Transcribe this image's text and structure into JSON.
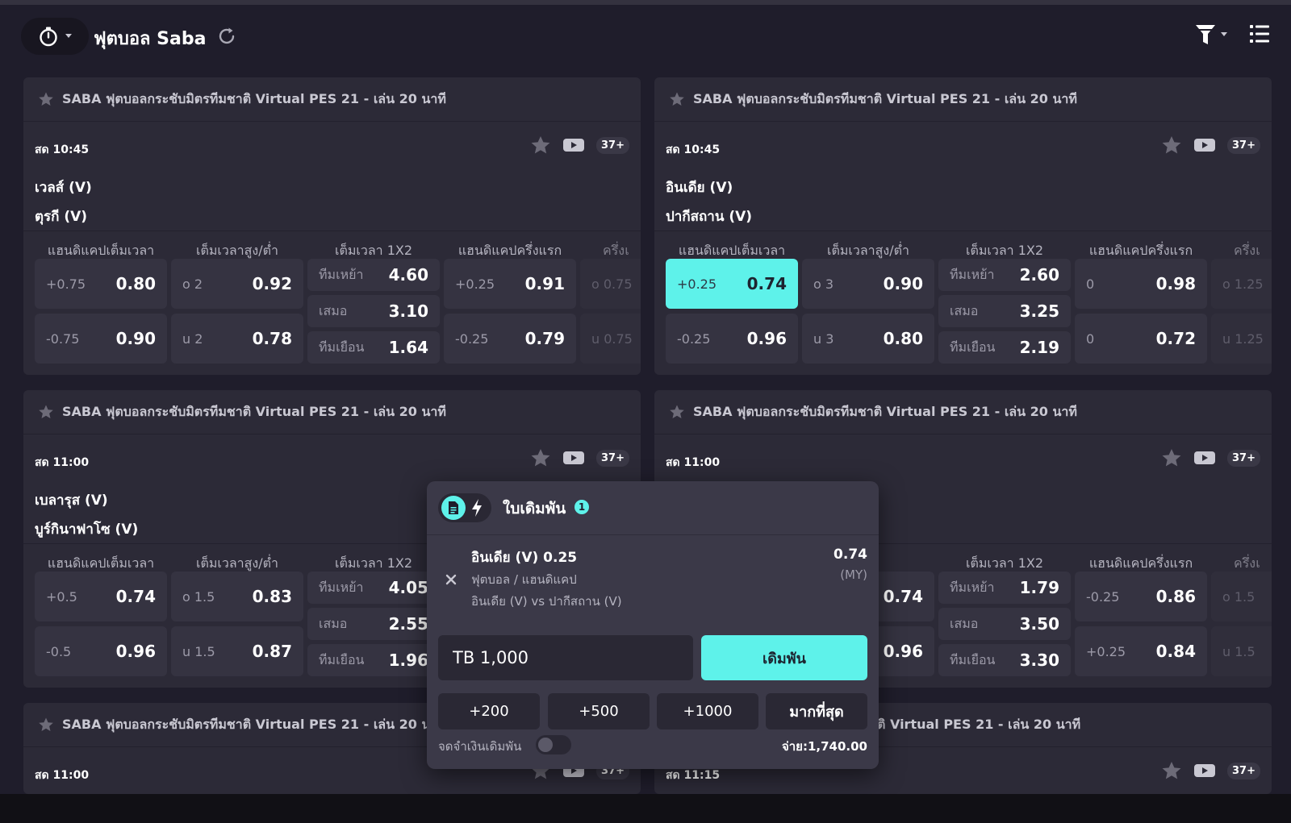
{
  "header": {
    "title": "ฟุตบอล Saba",
    "icons": {
      "timer": "stopwatch-icon",
      "refresh": "refresh-icon",
      "filter": "filter-icon",
      "list": "list-icon"
    }
  },
  "colors": {
    "background": "#1f1d2b",
    "card": "#2c2a37",
    "cell": "#353341",
    "accent": "#5ef2ea"
  },
  "market_headers": [
    "แฮนดิแคปเต็มเวลา",
    "เต็มเวลาสูง/ต่ำ",
    "เต็มเวลา 1X2",
    "แฮนดิแคปครึ่งแรก",
    "ครึ่งแ"
  ],
  "x12_labels": [
    "ทีมเหย้า",
    "เสมอ",
    "ทีมเยือน"
  ],
  "cards": [
    {
      "league": "SABA ฟุตบอลกระชับมิตรทีมชาติ Virtual PES 21 - เล่น 20 นาที",
      "time": "สด 10:45",
      "more": "37+",
      "home": "เวลส์ (V)",
      "away": "ตุรกี (V)",
      "hdp": [
        {
          "line": "+0.75",
          "odds": "0.80"
        },
        {
          "line": "-0.75",
          "odds": "0.90"
        }
      ],
      "ou": [
        {
          "line": "o 2",
          "odds": "0.92"
        },
        {
          "line": "u 2",
          "odds": "0.78"
        }
      ],
      "x12": [
        "4.60",
        "3.10",
        "1.64"
      ],
      "hdp1h": [
        {
          "line": "+0.25",
          "odds": "0.91"
        },
        {
          "line": "-0.25",
          "odds": "0.79"
        }
      ],
      "ou1h": [
        "o 0.75",
        "u 0.75"
      ]
    },
    {
      "league": "SABA ฟุตบอลกระชับมิตรทีมชาติ Virtual PES 21 - เล่น 20 นาที",
      "time": "สด 10:45",
      "more": "37+",
      "home": "อินเดีย (V)",
      "away": "ปากีสถาน (V)",
      "hdp": [
        {
          "line": "+0.25",
          "odds": "0.74",
          "selected": true
        },
        {
          "line": "-0.25",
          "odds": "0.96"
        }
      ],
      "ou": [
        {
          "line": "o 3",
          "odds": "0.90"
        },
        {
          "line": "u 3",
          "odds": "0.80"
        }
      ],
      "x12": [
        "2.60",
        "3.25",
        "2.19"
      ],
      "hdp1h": [
        {
          "line": "0",
          "odds": "0.98"
        },
        {
          "line": "0",
          "odds": "0.72"
        }
      ],
      "ou1h": [
        "o 1.25",
        "u 1.25"
      ]
    },
    {
      "league": "SABA ฟุตบอลกระชับมิตรทีมชาติ Virtual PES 21 - เล่น 20 นาที",
      "time": "สด 11:00",
      "more": "37+",
      "home": "เบลารุส (V)",
      "away": "บูร์กินาฟาโซ (V)",
      "hdp": [
        {
          "line": "+0.5",
          "odds": "0.74"
        },
        {
          "line": "-0.5",
          "odds": "0.96"
        }
      ],
      "ou": [
        {
          "line": "o 1.5",
          "odds": "0.83"
        },
        {
          "line": "u 1.5",
          "odds": "0.87"
        }
      ],
      "x12": [
        "4.05",
        "2.55",
        "1.96"
      ]
    },
    {
      "league": "SABA ฟุตบอลกระชับมิตรทีมชาติ Virtual PES 21 - เล่น 20 นาที",
      "time": "สด 11:00",
      "more": "37+",
      "hdp": [
        {
          "line": "",
          "odds": ""
        },
        {
          "line": "",
          "odds": ""
        }
      ],
      "ou": [
        {
          "line": "",
          "odds": "0.74"
        },
        {
          "line": "",
          "odds": "0.96"
        }
      ],
      "x12": [
        "1.79",
        "3.50",
        "3.30"
      ],
      "hdp1h": [
        {
          "line": "-0.25",
          "odds": "0.86"
        },
        {
          "line": "+0.25",
          "odds": "0.84"
        }
      ],
      "ou1h": [
        "o 1.5",
        "u 1.5"
      ]
    },
    {
      "league": "SABA ฟุตบอลกระชับมิตรทีมชาติ Virtual PES 21 - เล่น 20 น",
      "time": "สด 11:00",
      "more": "37+"
    },
    {
      "league": "ติ Virtual PES 21 - เล่น 20 นาที",
      "time": "สด 11:15",
      "more": "37+"
    }
  ],
  "bet_slip": {
    "title": "ใบเดิมพัน",
    "count": "1",
    "selection": "อินเดีย (V) 0.25",
    "market": "ฟุตบอล / แฮนดิแคป",
    "match": "อินเดีย (V) vs ปากีสถาน (V)",
    "odds": "0.74",
    "odds_format": "(MY)",
    "stake": "TB 1,000",
    "place_label": "เดิมพัน",
    "quick_amounts": [
      "+200",
      "+500",
      "+1000",
      "มากที่สุด"
    ],
    "remember_label": "จดจำเงินเดิมพัน",
    "payout": "จ่าย:1,740.00"
  }
}
